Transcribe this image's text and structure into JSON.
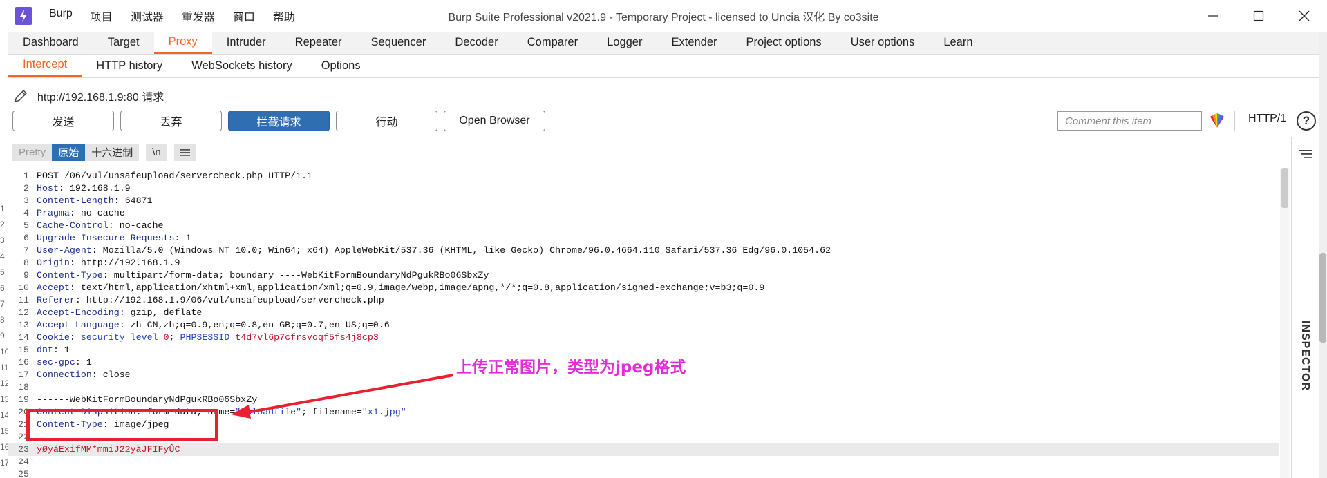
{
  "window": {
    "title": "Burp Suite Professional v2021.9 - Temporary Project - licensed to Uncia 汉化 By co3site",
    "menu": [
      "Burp",
      "项目",
      "测试器",
      "重发器",
      "窗口",
      "帮助"
    ]
  },
  "main_tabs": [
    {
      "label": "Dashboard",
      "active": false
    },
    {
      "label": "Target",
      "active": false
    },
    {
      "label": "Proxy",
      "active": true
    },
    {
      "label": "Intruder",
      "active": false
    },
    {
      "label": "Repeater",
      "active": false
    },
    {
      "label": "Sequencer",
      "active": false
    },
    {
      "label": "Decoder",
      "active": false
    },
    {
      "label": "Comparer",
      "active": false
    },
    {
      "label": "Logger",
      "active": false
    },
    {
      "label": "Extender",
      "active": false
    },
    {
      "label": "Project options",
      "active": false
    },
    {
      "label": "User options",
      "active": false
    },
    {
      "label": "Learn",
      "active": false
    }
  ],
  "sub_tabs": [
    {
      "label": "Intercept",
      "active": true
    },
    {
      "label": "HTTP history",
      "active": false
    },
    {
      "label": "WebSockets history",
      "active": false
    },
    {
      "label": "Options",
      "active": false
    }
  ],
  "target": "http://192.168.1.9:80 请求",
  "actions": {
    "forward": "发送",
    "drop": "丢弃",
    "intercept": "拦截请求",
    "action": "行动",
    "open_browser": "Open Browser"
  },
  "comment_placeholder": "Comment this item",
  "http_version": "HTTP/1",
  "help": "?",
  "editor_views": {
    "pretty": "Pretty",
    "raw": "原始",
    "hex": "十六进制",
    "newline": "\\n"
  },
  "inspector_label": "INSPECTOR",
  "request_lines": [
    {
      "n": "1",
      "name": "",
      "sep": "",
      "value": "POST /06/vul/unsafeupload/servercheck.php HTTP/1.1"
    },
    {
      "n": "2",
      "name": "Host",
      "sep": ": ",
      "value": "192.168.1.9"
    },
    {
      "n": "3",
      "name": "Content-Length",
      "sep": ": ",
      "value": "64871"
    },
    {
      "n": "4",
      "name": "Pragma",
      "sep": ": ",
      "value": "no-cache"
    },
    {
      "n": "5",
      "name": "Cache-Control",
      "sep": ": ",
      "value": "no-cache"
    },
    {
      "n": "6",
      "name": "Upgrade-Insecure-Requests",
      "sep": ": ",
      "value": "1"
    },
    {
      "n": "7",
      "name": "User-Agent",
      "sep": ": ",
      "value": "Mozilla/5.0 (Windows NT 10.0; Win64; x64) AppleWebKit/537.36 (KHTML, like Gecko) Chrome/96.0.4664.110 Safari/537.36 Edg/96.0.1054.62"
    },
    {
      "n": "8",
      "name": "Origin",
      "sep": ": ",
      "value": "http://192.168.1.9"
    },
    {
      "n": "9",
      "name": "Content-Type",
      "sep": ": ",
      "value": "multipart/form-data; boundary=----WebKitFormBoundaryNdPgukRBo06SbxZy"
    },
    {
      "n": "10",
      "name": "Accept",
      "sep": ": ",
      "value": "text/html,application/xhtml+xml,application/xml;q=0.9,image/webp,image/apng,*/*;q=0.8,application/signed-exchange;v=b3;q=0.9"
    },
    {
      "n": "11",
      "name": "Referer",
      "sep": ": ",
      "value": "http://192.168.1.9/06/vul/unsafeupload/servercheck.php"
    },
    {
      "n": "12",
      "name": "Accept-Encoding",
      "sep": ": ",
      "value": "gzip, deflate"
    },
    {
      "n": "13",
      "name": "Accept-Language",
      "sep": ": ",
      "value": "zh-CN,zh;q=0.9,en;q=0.8,en-GB;q=0.7,en-US;q=0.6"
    },
    {
      "n": "14",
      "name": "Cookie",
      "sep": ": ",
      "value": ""
    },
    {
      "n": "15",
      "name": "dnt",
      "sep": ": ",
      "value": "1"
    },
    {
      "n": "16",
      "name": "sec-gpc",
      "sep": ": ",
      "value": "1"
    },
    {
      "n": "17",
      "name": "Connection",
      "sep": ": ",
      "value": "close"
    },
    {
      "n": "18",
      "name": "",
      "sep": "",
      "value": ""
    },
    {
      "n": "19",
      "name": "",
      "sep": "",
      "value": "------WebKitFormBoundaryNdPgukRBo06SbxZy"
    },
    {
      "n": "20",
      "name": "",
      "sep": "",
      "value": ""
    },
    {
      "n": "21",
      "name": "Content-Type",
      "sep": ": ",
      "value": "image/jpeg"
    },
    {
      "n": "22",
      "name": "",
      "sep": "",
      "value": ""
    },
    {
      "n": "23",
      "name": "",
      "sep": "",
      "value": ""
    },
    {
      "n": "24",
      "name": "",
      "sep": "",
      "value": ""
    },
    {
      "n": "25",
      "name": "",
      "sep": "",
      "value": ""
    }
  ],
  "cookie": {
    "k1": "security_level",
    "eq1": "=",
    "v1": "0",
    "semi": "; ",
    "k2": "PHPSESSID",
    "eq2": "=",
    "v2": "t4d7vl6p7cfrsvoqf5fs4j8cp3"
  },
  "disposition": {
    "prefix": "Content-Disp",
    "mid": "sition: form-data; ",
    "hidden": "na",
    "name_key": "me=",
    "name_val": "\"uploadfile\"",
    "sep": "; filename=",
    "file_val": "\"x1.jpg\""
  },
  "binary_line": "ÿØÿá\u0018ExifMM*mm\u0006iJ2\u00062yàJFIFyÛC",
  "left_edge_fragments": [
    "1",
    "2",
    "3",
    "4",
    "5",
    "6",
    "7",
    "8",
    "9",
    "10",
    "11",
    "12",
    "13",
    "14",
    "15",
    "16",
    "17"
  ],
  "annotation": {
    "text": "上传正常图片，类型为jpeg格式",
    "color": "#e32ed8",
    "box_color": "#e8202f"
  },
  "colors": {
    "accent": "#f26522",
    "primary_button": "#2f6fb1",
    "header_name": "#1c2f8c",
    "string_value": "#2443c8",
    "cookie_value": "#c8102e"
  }
}
